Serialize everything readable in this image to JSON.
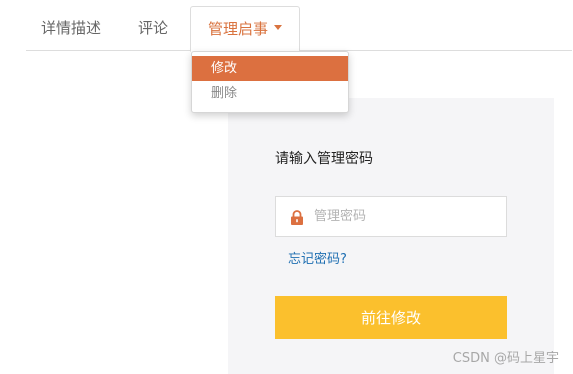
{
  "tabs": {
    "detail": "详情描述",
    "comment": "评论",
    "manage": "管理启事"
  },
  "dropdown": {
    "items": [
      "修改",
      "删除"
    ],
    "active_index": 0
  },
  "panel": {
    "title": "请输入管理密码",
    "password_placeholder": "管理密码",
    "password_value": "",
    "forgot_link": "忘记密码?",
    "submit_label": "前往修改"
  },
  "watermark": "CSDN @码上星宇",
  "colors": {
    "accent": "#dc7040",
    "button": "#fbc02d",
    "link": "#1f6fb2",
    "panel_bg": "#f5f5f7"
  },
  "icons": {
    "lock": "lock-icon",
    "caret": "caret-down-icon"
  }
}
